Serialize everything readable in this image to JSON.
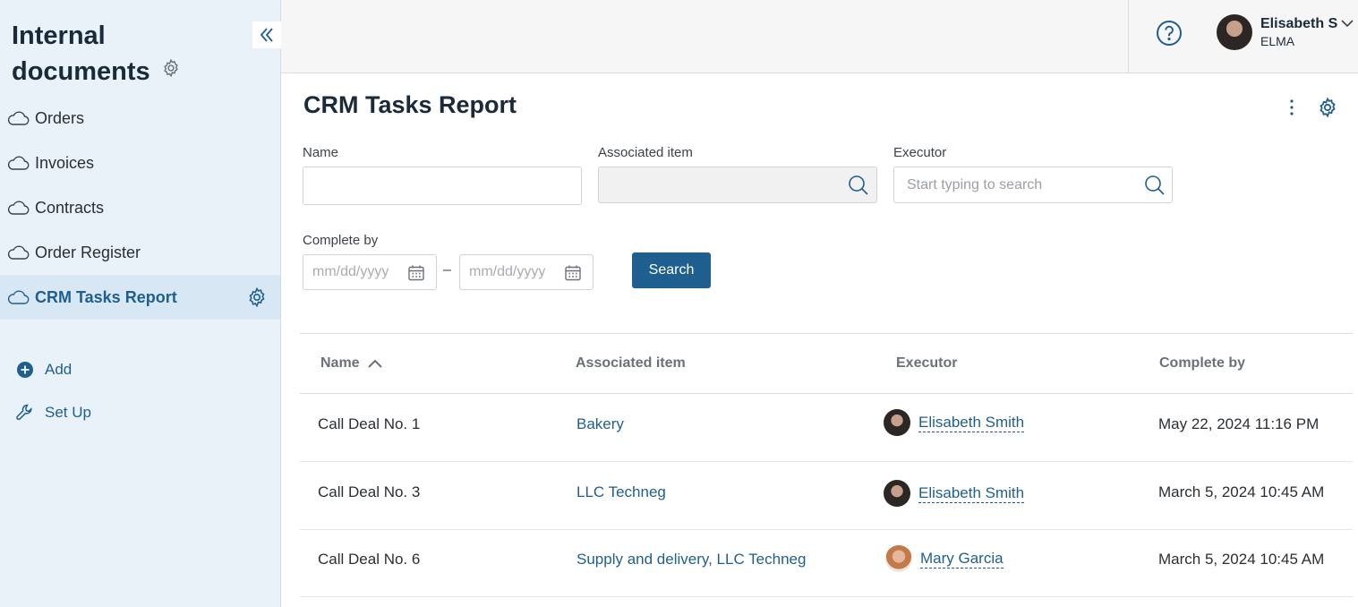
{
  "sidebar": {
    "title": "Internal documents",
    "items": [
      {
        "label": "Orders"
      },
      {
        "label": "Invoices"
      },
      {
        "label": "Contracts"
      },
      {
        "label": "Order Register"
      },
      {
        "label": "CRM Tasks Report",
        "active": true
      }
    ],
    "actions": {
      "add": "Add",
      "setup": "Set Up"
    }
  },
  "topbar": {
    "user_name": "Elisabeth S",
    "user_org": "ELMA"
  },
  "page": {
    "title": "CRM Tasks Report"
  },
  "filters": {
    "name_label": "Name",
    "name_value": "",
    "assoc_label": "Associated item",
    "executor_label": "Executor",
    "executor_placeholder": "Start typing to search",
    "complete_label": "Complete by",
    "date_from_placeholder": "mm/dd/yyyy",
    "date_to_placeholder": "mm/dd/yyyy",
    "date_separator": "–",
    "search_button": "Search"
  },
  "table": {
    "columns": [
      "Name",
      "Associated item",
      "Executor",
      "Complete by"
    ],
    "rows": [
      {
        "name": "Call Deal No. 1",
        "assoc": "Bakery",
        "executor": "Elisabeth Smith",
        "date": "May 22, 2024 11:16 PM"
      },
      {
        "name": "Call Deal No. 3",
        "assoc": "LLC Techneg",
        "executor": "Elisabeth Smith",
        "date": "March 5, 2024 10:45 AM"
      },
      {
        "name": "Call Deal No. 6",
        "assoc": "Supply and delivery, LLC Techneg",
        "executor": "Mary Garcia",
        "date": "March 5, 2024 10:45 AM"
      }
    ]
  },
  "colors": {
    "accent": "#1f5f8f",
    "sidebar_bg": "#e9f2f9",
    "active_bg": "#d7e7f4"
  }
}
